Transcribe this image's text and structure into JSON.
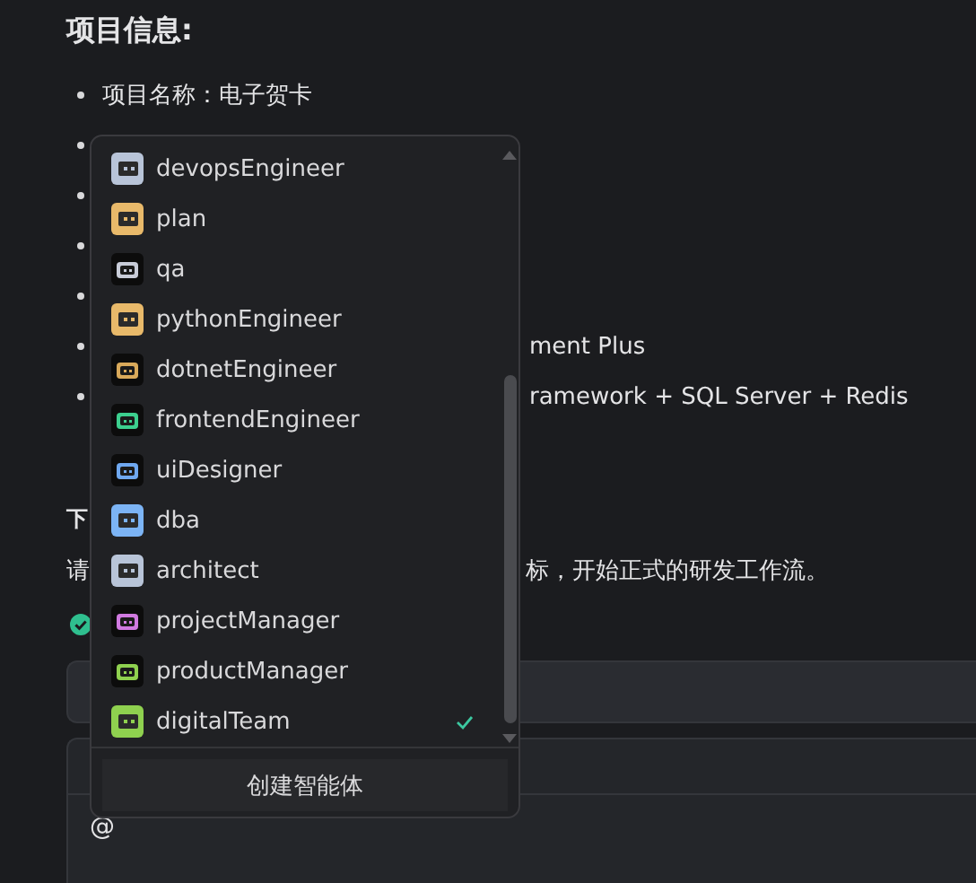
{
  "heading": "项目信息:",
  "bullets": [
    {
      "kind": "text",
      "text": "项目名称：电子贺卡"
    },
    {
      "kind": "marker"
    },
    {
      "kind": "marker"
    },
    {
      "kind": "marker"
    },
    {
      "kind": "marker"
    },
    {
      "kind": "tail",
      "text": "ment Plus"
    },
    {
      "kind": "tail",
      "text": "ramework + SQL Server + Redis"
    }
  ],
  "next_heading": "下",
  "paragraph_start": "请",
  "paragraph_end": "标，开始正式的研发工作流。",
  "composer": {
    "prefix": "@"
  },
  "dropdown": {
    "items": [
      {
        "name": "devopsEngineer",
        "kind": "filled",
        "color": "#b8c4d8",
        "selected": false
      },
      {
        "name": "plan",
        "kind": "filled",
        "color": "#e8b96a",
        "selected": false
      },
      {
        "name": "qa",
        "kind": "dark",
        "color": "#c8ccd8",
        "selected": false
      },
      {
        "name": "pythonEngineer",
        "kind": "filled",
        "color": "#e8b96a",
        "selected": false
      },
      {
        "name": "dotnetEngineer",
        "kind": "dark",
        "color": "#d9a95a",
        "selected": false
      },
      {
        "name": "frontendEngineer",
        "kind": "dark",
        "color": "#3ccf8e",
        "selected": false
      },
      {
        "name": "uiDesigner",
        "kind": "dark",
        "color": "#6fa8f0",
        "selected": false
      },
      {
        "name": "dba",
        "kind": "filled",
        "color": "#7cb4f5",
        "selected": false
      },
      {
        "name": "architect",
        "kind": "filled",
        "color": "#b8c4d8",
        "selected": false
      },
      {
        "name": "projectManager",
        "kind": "dark",
        "color": "#d07ae0",
        "selected": false
      },
      {
        "name": "productManager",
        "kind": "dark",
        "color": "#8fd14f",
        "selected": false
      },
      {
        "name": "digitalTeam",
        "kind": "filled",
        "color": "#8fd14f",
        "selected": true
      }
    ],
    "create_button": "创建智能体"
  }
}
